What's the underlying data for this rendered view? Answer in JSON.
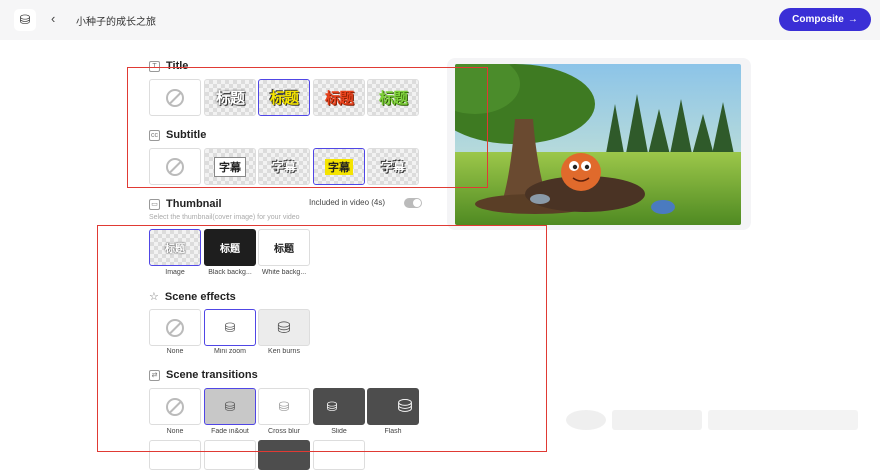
{
  "header": {
    "back_icon": "chevron-left-icon",
    "project_title": "小种子的成长之旅",
    "composite_label": "Composite",
    "composite_arrow": "→"
  },
  "title_section": {
    "label": "Title",
    "sample": "标题",
    "selected_index": 2
  },
  "subtitle_section": {
    "label": "Subtitle",
    "sample": "字幕",
    "selected_index": 3
  },
  "thumbnail_section": {
    "label": "Thumbnail",
    "toggle_label": "Included in video (4s)",
    "note": "Select the thumbnail(cover image) for your video",
    "sample": "标题",
    "options": [
      "Image",
      "Black backg...",
      "White backg..."
    ]
  },
  "scene_effects": {
    "label": "Scene effects",
    "options": [
      "None",
      "Mini zoom",
      "Ken burns"
    ]
  },
  "scene_transitions": {
    "label": "Scene transitions",
    "options": [
      "None",
      "Fade in&out",
      "Cross blur",
      "Slide",
      "Flash"
    ]
  },
  "colors": {
    "accent": "#3a2fd6",
    "highlight_box": "#e03a34",
    "selected_border": "#5046e5"
  }
}
